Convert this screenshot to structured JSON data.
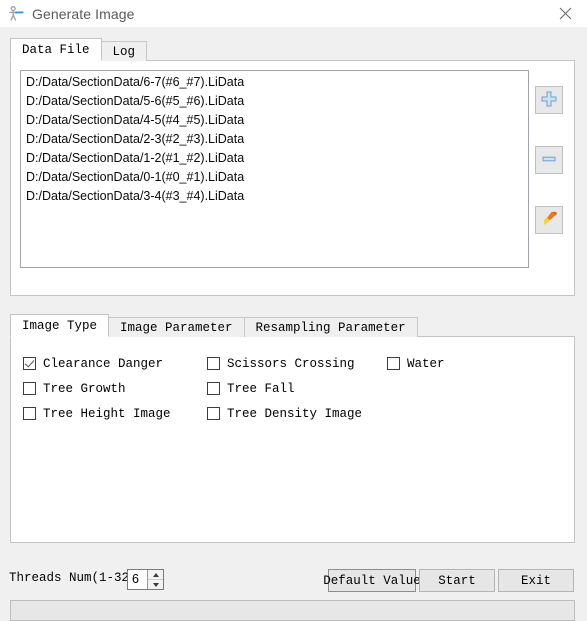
{
  "window": {
    "title": "Generate Image",
    "icon": "app-figure-icon",
    "close_icon": "close-icon"
  },
  "top_tabs": {
    "items": [
      {
        "label": "Data File",
        "active": true
      },
      {
        "label": "Log",
        "active": false
      }
    ]
  },
  "file_list": {
    "items": [
      "D:/Data/SectionData/6-7(#6_#7).LiData",
      "D:/Data/SectionData/5-6(#5_#6).LiData",
      "D:/Data/SectionData/4-5(#4_#5).LiData",
      "D:/Data/SectionData/2-3(#2_#3).LiData",
      "D:/Data/SectionData/1-2(#1_#2).LiData",
      "D:/Data/SectionData/0-1(#0_#1).LiData",
      "D:/Data/SectionData/3-4(#3_#4).LiData"
    ]
  },
  "side_buttons": [
    {
      "name": "add-file-button",
      "icon": "plus-icon",
      "color": "#7fb0de"
    },
    {
      "name": "remove-file-button",
      "icon": "minus-icon",
      "color": "#7fb0de"
    },
    {
      "name": "clear-list-button",
      "icon": "brush-icon",
      "color": "#f0c040"
    }
  ],
  "bottom_tabs": {
    "items": [
      {
        "label": "Image Type",
        "active": true
      },
      {
        "label": "Image Parameter",
        "active": false
      },
      {
        "label": "Resampling Parameter",
        "active": false
      }
    ]
  },
  "image_type": {
    "rows": [
      [
        {
          "label": "Clearance Danger",
          "checked": true
        },
        {
          "label": "Scissors Crossing",
          "checked": false
        },
        {
          "label": "Water",
          "checked": false
        }
      ],
      [
        {
          "label": "Tree Growth",
          "checked": false
        },
        {
          "label": "Tree Fall",
          "checked": false
        },
        {
          "label": "",
          "checked": false
        }
      ],
      [
        {
          "label": "Tree Height Image",
          "checked": false
        },
        {
          "label": "Tree Density Image",
          "checked": false
        },
        {
          "label": "",
          "checked": false
        }
      ]
    ]
  },
  "threads": {
    "label": "Threads Num(1-32):",
    "value": "6"
  },
  "actions": {
    "default_value": "Default Value",
    "start": "Start",
    "exit": "Exit"
  }
}
